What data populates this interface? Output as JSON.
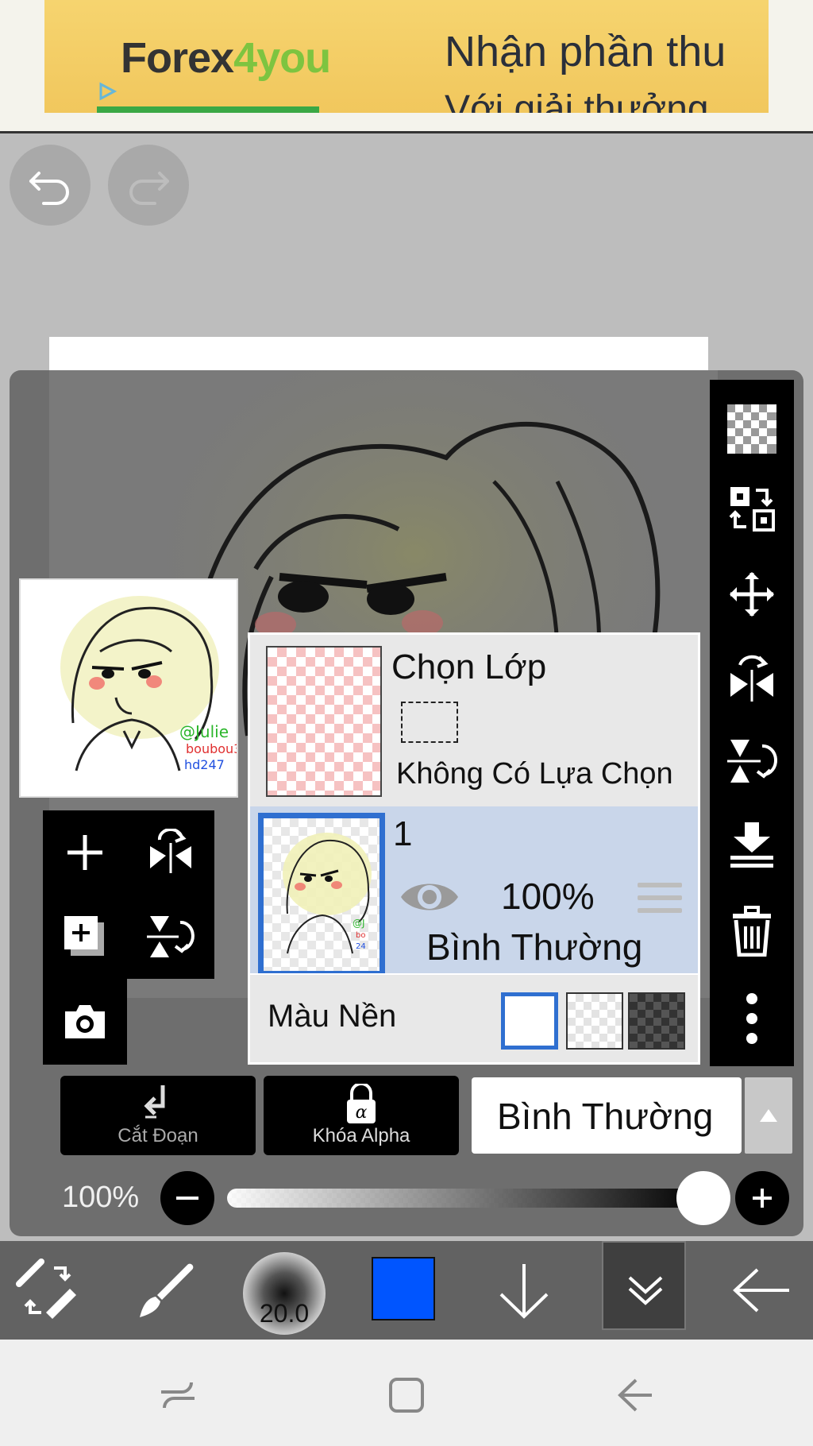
{
  "ad": {
    "logo_text": "Forex",
    "logo_four": "4",
    "logo_you": "you",
    "headline": "Nhận phần thu",
    "subline": "Với giải thưởng"
  },
  "toolbar": {
    "undo_icon": "undo-icon",
    "redo_icon": "redo-icon"
  },
  "right_toolbar": [
    "checkerboard-icon",
    "transform-icon",
    "move-icon",
    "flip-horizontal-icon",
    "flip-vertical-icon",
    "merge-down-icon",
    "trash-icon",
    "more-icon"
  ],
  "left_tools": [
    "add-layer-icon",
    "flip-horizontal-icon",
    "duplicate-layer-icon",
    "flip-vertical-icon",
    "camera-icon"
  ],
  "layer_panel": {
    "selection_title": "Chọn Lớp",
    "selection_empty": "Không Có Lựa Chọn",
    "layer": {
      "name": "1",
      "opacity": "100%",
      "blend_mode": "Bình Thường"
    },
    "background_label": "Màu Nền"
  },
  "layer_controls": {
    "clip_label": "Cắt Đoạn",
    "alpha_lock_label": "Khóa Alpha",
    "blend_mode": "Bình Thường"
  },
  "opacity": {
    "label": "100%",
    "value": 1.0
  },
  "bottom_toolbar": {
    "brush_size": "20.0",
    "current_color": "#0055ff"
  },
  "colors": {
    "accent_blue": "#2f6fd0",
    "selected_layer_bg": "#c9d6ea",
    "panel_bg": "#e8e8e8"
  }
}
